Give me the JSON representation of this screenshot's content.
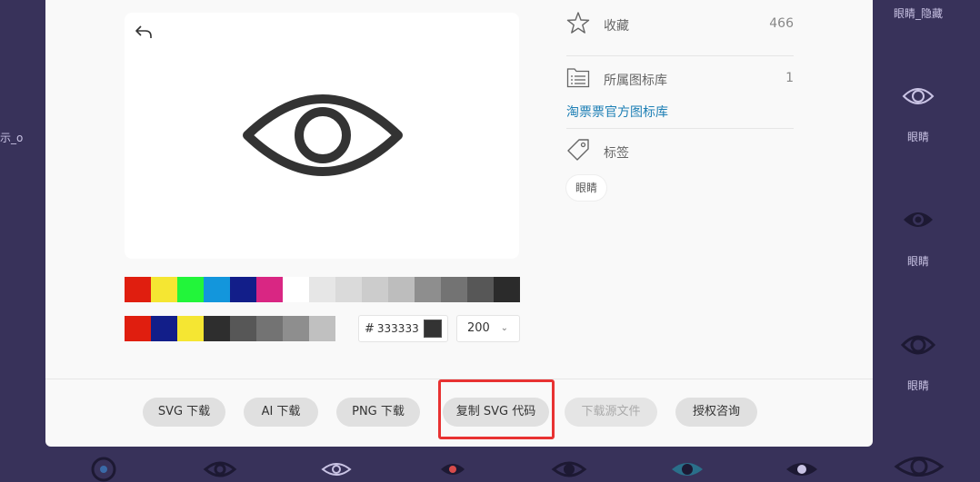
{
  "background": {
    "labels_left": [
      "示_o"
    ],
    "labels_right": [
      "眼睛_隐藏",
      "眼睛",
      "眼睛",
      "眼睛"
    ]
  },
  "icon": {
    "name": "eye-icon",
    "color": "#333333"
  },
  "palette": {
    "row1": [
      "#e01e0f",
      "#f5e632",
      "#22f53a",
      "#1396dc",
      "#121e89",
      "#d92683",
      "#ffffff",
      "#e6e6e6",
      "#dadada",
      "#cccccc",
      "#bdbdbd",
      "#8e8e8e",
      "#737373",
      "#575757",
      "#2b2b2b"
    ],
    "row2": [
      "#e01e0f",
      "#121e89",
      "#f5e632",
      "#2e2e2e",
      "#575757",
      "#737373",
      "#8e8e8e",
      "#c0c0c0"
    ]
  },
  "color_input": {
    "hash": "#",
    "value": "333333"
  },
  "size_select": {
    "value": "200"
  },
  "info": {
    "favorite_label": "收藏",
    "favorite_count": "466",
    "library_label": "所属图标库",
    "library_count": "1",
    "library_link": "淘票票官方图标库",
    "tags_label": "标签",
    "tag": "眼睛"
  },
  "buttons": {
    "svg_download": "SVG 下载",
    "ai_download": "AI 下载",
    "png_download": "PNG 下载",
    "copy_svg": "复制 SVG 代码",
    "download_source": "下载源文件",
    "license": "授权咨询"
  }
}
